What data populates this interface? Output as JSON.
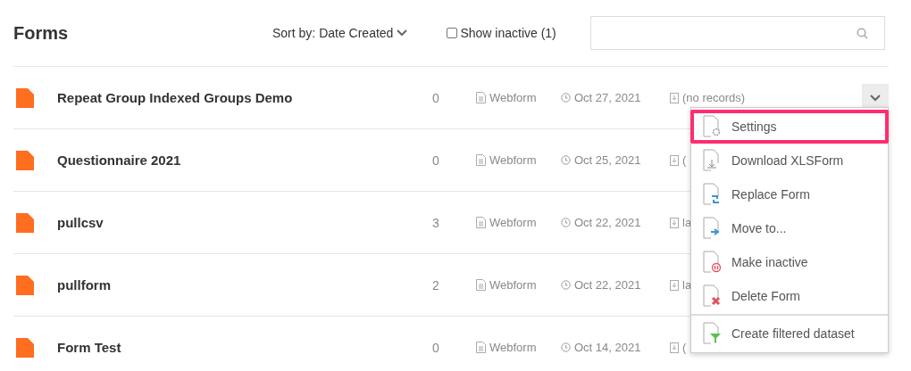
{
  "header": {
    "title": "Forms",
    "sort": {
      "label": "Sort by: Date Created"
    },
    "show_inactive": {
      "label": "Show inactive (1)",
      "checked": false
    }
  },
  "rows": [
    {
      "name": "Repeat Group Indexed Groups Demo",
      "count": "0",
      "type": "Webform",
      "date": "Oct 27, 2021",
      "records": "(no records)",
      "menu_open": true
    },
    {
      "name": "Questionnaire 2021",
      "count": "0",
      "type": "Webform",
      "date": "Oct 25, 2021",
      "records": "(",
      "menu_open": false
    },
    {
      "name": "pullcsv",
      "count": "3",
      "type": "Webform",
      "date": "Oct 22, 2021",
      "records": "la",
      "menu_open": false
    },
    {
      "name": "pullform",
      "count": "2",
      "type": "Webform",
      "date": "Oct 22, 2021",
      "records": "la",
      "menu_open": false
    },
    {
      "name": "Form Test",
      "count": "0",
      "type": "Webform",
      "date": "Oct 14, 2021",
      "records": "(",
      "menu_open": false
    }
  ],
  "menu": [
    {
      "kind": "settings",
      "label": "Settings",
      "highlighted": true
    },
    {
      "kind": "download",
      "label": "Download XLSForm",
      "highlighted": false
    },
    {
      "kind": "replace",
      "label": "Replace Form",
      "highlighted": false
    },
    {
      "kind": "move",
      "label": "Move to...",
      "highlighted": false
    },
    {
      "kind": "inactive",
      "label": "Make inactive",
      "highlighted": false
    },
    {
      "kind": "delete",
      "label": "Delete Form",
      "highlighted": false
    },
    {
      "kind": "divider"
    },
    {
      "kind": "filter",
      "label": "Create filtered dataset",
      "highlighted": false
    }
  ]
}
